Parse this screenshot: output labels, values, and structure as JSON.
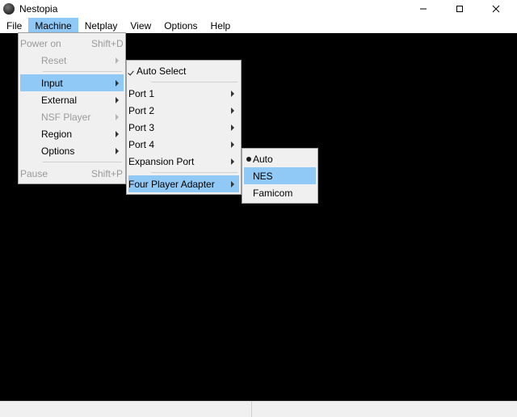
{
  "window": {
    "title": "Nestopia"
  },
  "menubar": {
    "items": [
      "File",
      "Machine",
      "Netplay",
      "View",
      "Options",
      "Help"
    ],
    "open_index": 1
  },
  "machine_menu": {
    "power_on": "Power on",
    "power_on_accel": "Shift+D",
    "reset": "Reset",
    "input": "Input",
    "external": "External",
    "nsf_player": "NSF Player",
    "region": "Region",
    "options": "Options",
    "pause": "Pause",
    "pause_accel": "Shift+P"
  },
  "input_menu": {
    "auto_select": "Auto Select",
    "port1": "Port 1",
    "port2": "Port 2",
    "port3": "Port 3",
    "port4": "Port 4",
    "expansion_port": "Expansion Port",
    "four_player_adapter": "Four Player Adapter"
  },
  "fpa_menu": {
    "auto": "Auto",
    "nes": "NES",
    "famicom": "Famicom"
  },
  "statusbar": {
    "seg1_width": 312
  }
}
